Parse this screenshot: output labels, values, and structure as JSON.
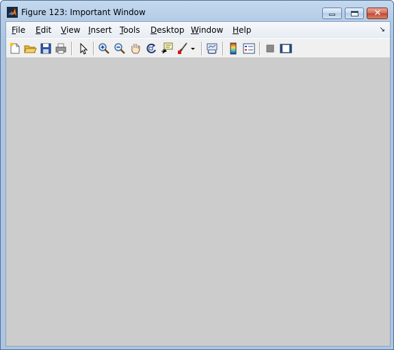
{
  "window": {
    "title": "Figure 123: Important Window",
    "app_icon": "matlab-icon"
  },
  "menubar": {
    "items": [
      {
        "mnemonic": "F",
        "rest": "ile"
      },
      {
        "mnemonic": "E",
        "rest": "dit"
      },
      {
        "mnemonic": "V",
        "rest": "iew"
      },
      {
        "mnemonic": "I",
        "rest": "nsert"
      },
      {
        "mnemonic": "T",
        "rest": "ools"
      },
      {
        "mnemonic": "D",
        "rest": "esktop"
      },
      {
        "mnemonic": "W",
        "rest": "indow"
      },
      {
        "mnemonic": "H",
        "rest": "elp"
      }
    ],
    "dock_icon": "dock-arrow-icon"
  },
  "toolbar": {
    "icons": [
      "new-figure-icon",
      "open-file-icon",
      "save-icon",
      "print-icon",
      "edit-plot-icon",
      "zoom-in-icon",
      "zoom-out-icon",
      "pan-icon",
      "rotate-3d-icon",
      "data-cursor-icon",
      "brush-icon",
      "brush-dropdown-icon",
      "link-plot-icon",
      "insert-colorbar-icon",
      "insert-legend-icon",
      "hide-plot-tools-icon",
      "show-plot-tools-icon"
    ]
  },
  "colors": {
    "title_bar": "#b3cbe6",
    "figure_background": "#cccccc",
    "close_button": "#c0432d"
  }
}
